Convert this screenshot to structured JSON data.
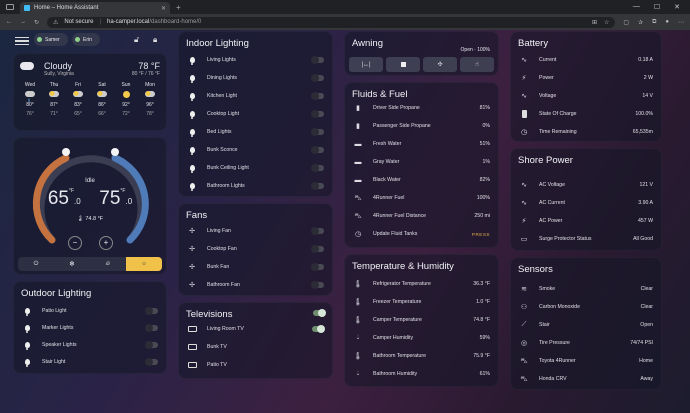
{
  "browser": {
    "tab_title": "Home – Home Assistant",
    "not_secure": "Not secure",
    "url_host": "ha-camper.local",
    "url_path": "/dashboard-home/0"
  },
  "users": {
    "user1": "Samer",
    "user2": "Erin"
  },
  "weather": {
    "condition": "Cloudy",
    "location": "Sully, Virginia",
    "temp": "78 °F",
    "range": "80 °F / 76 °F",
    "forecast": [
      {
        "day": "Wed",
        "high": "80°",
        "low": "76°"
      },
      {
        "day": "Thu",
        "high": "87°",
        "low": "71°"
      },
      {
        "day": "Fri",
        "high": "83°",
        "low": "65°"
      },
      {
        "day": "Sat",
        "high": "86°",
        "low": "66°"
      },
      {
        "day": "Sun",
        "high": "92°",
        "low": "72°"
      },
      {
        "day": "Mon",
        "high": "96°",
        "low": "78°"
      }
    ]
  },
  "thermostat": {
    "state": "Idle",
    "low": "65",
    "low_dec": ".0",
    "high": "75",
    "high_dec": ".0",
    "unit": "°F",
    "current": "74.8 °F",
    "minus": "−",
    "plus": "+"
  },
  "outdoor": {
    "title": "Outdoor Lighting",
    "items": [
      "Patio Light",
      "Marker Lights",
      "Speaker Lights",
      "Stair Light"
    ]
  },
  "indoor": {
    "title": "Indoor Lighting",
    "items": [
      "Living Lights",
      "Dining Lights",
      "Kitchen Light",
      "Cooktop Light",
      "Bed Lights",
      "Bunk Sconce",
      "Bunk Ceiling Light",
      "Bathroom Lights"
    ]
  },
  "fans": {
    "title": "Fans",
    "items": [
      "Living Fan",
      "Cooktop Fan",
      "Bunk Fan",
      "Bathroom Fan"
    ]
  },
  "tv": {
    "title": "Televisions",
    "items": [
      {
        "name": "Living Room TV",
        "on": true
      },
      {
        "name": "Bunk TV",
        "on": false
      },
      {
        "name": "Patio TV",
        "on": false
      }
    ]
  },
  "awning": {
    "title": "Awning",
    "status": "Open · 100%"
  },
  "fluids": {
    "title": "Fluids & Fuel",
    "items": [
      {
        "name": "Driver Side Propane",
        "value": "81%"
      },
      {
        "name": "Passenger Side Propane",
        "value": "0%"
      },
      {
        "name": "Fresh Water",
        "value": "51%"
      },
      {
        "name": "Gray Water",
        "value": "1%"
      },
      {
        "name": "Black Water",
        "value": "82%"
      },
      {
        "name": "4Runner Fuel",
        "value": "100%"
      },
      {
        "name": "4Runner Fuel Distance",
        "value": "250 mi"
      },
      {
        "name": "Update Fluid Tanks",
        "value": "PRESS"
      }
    ]
  },
  "temps": {
    "title": "Temperature & Humidity",
    "items": [
      {
        "name": "Refrigerator Temperature",
        "value": "36.3 °F"
      },
      {
        "name": "Freezer Temperature",
        "value": "1.0 °F"
      },
      {
        "name": "Camper Temperature",
        "value": "74.8 °F"
      },
      {
        "name": "Camper Humidity",
        "value": "59%"
      },
      {
        "name": "Bathroom Temperature",
        "value": "75.9 °F"
      },
      {
        "name": "Bathroom Humidity",
        "value": "61%"
      }
    ]
  },
  "battery": {
    "title": "Battery",
    "items": [
      {
        "name": "Current",
        "value": "0.18 A"
      },
      {
        "name": "Power",
        "value": "2 W"
      },
      {
        "name": "Voltage",
        "value": "14 V"
      },
      {
        "name": "State Of Charge",
        "value": "100.0%"
      },
      {
        "name": "Time Remaining",
        "value": "65,535m"
      }
    ]
  },
  "shore": {
    "title": "Shore Power",
    "items": [
      {
        "name": "AC Voltage",
        "value": "121 V"
      },
      {
        "name": "AC Current",
        "value": "3.90 A"
      },
      {
        "name": "AC Power",
        "value": "457 W"
      },
      {
        "name": "Surge Protector Status",
        "value": "All Good"
      }
    ]
  },
  "sensors": {
    "title": "Sensors",
    "items": [
      {
        "name": "Smoke",
        "value": "Clear"
      },
      {
        "name": "Carbon Monoxide",
        "value": "Clear"
      },
      {
        "name": "Stair",
        "value": "Open"
      },
      {
        "name": "Tire Pressure",
        "value": "74/74 PSI"
      },
      {
        "name": "Toyota 4Runner",
        "value": "Home"
      },
      {
        "name": "Honda CRV",
        "value": "Away"
      }
    ]
  }
}
